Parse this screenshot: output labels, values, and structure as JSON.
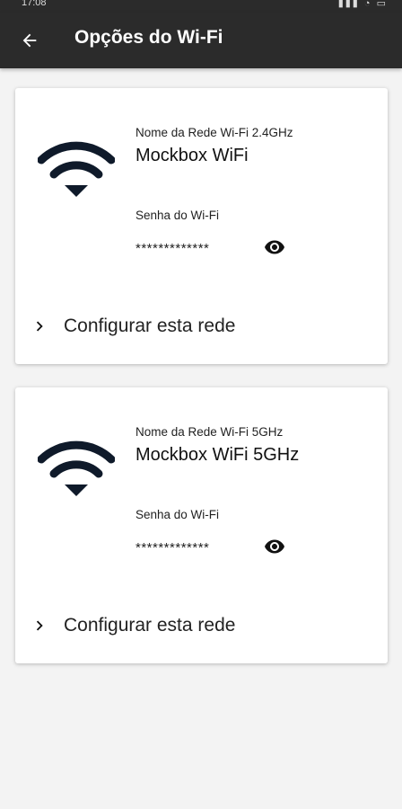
{
  "status_bar": {
    "time": "17:08",
    "icons": "signal-wifi-battery"
  },
  "app_bar": {
    "title": "Opções do Wi-Fi",
    "back_icon": "arrow-left-icon"
  },
  "networks": [
    {
      "band_label": "Nome da Rede Wi-Fi 2.4GHz",
      "ssid": "Mockbox WiFi",
      "password_label": "Senha do Wi-Fi",
      "password_masked": "*************",
      "configure_label": "Configurar esta rede"
    },
    {
      "band_label": "Nome da Rede Wi-Fi 5GHz",
      "ssid": "Mockbox WiFi 5GHz",
      "password_label": "Senha do Wi-Fi",
      "password_masked": "*************",
      "configure_label": "Configurar esta rede"
    }
  ],
  "colors": {
    "app_bar": "#2b2b2b",
    "background": "#f3f3f3",
    "icon": "#0f1a2a"
  }
}
